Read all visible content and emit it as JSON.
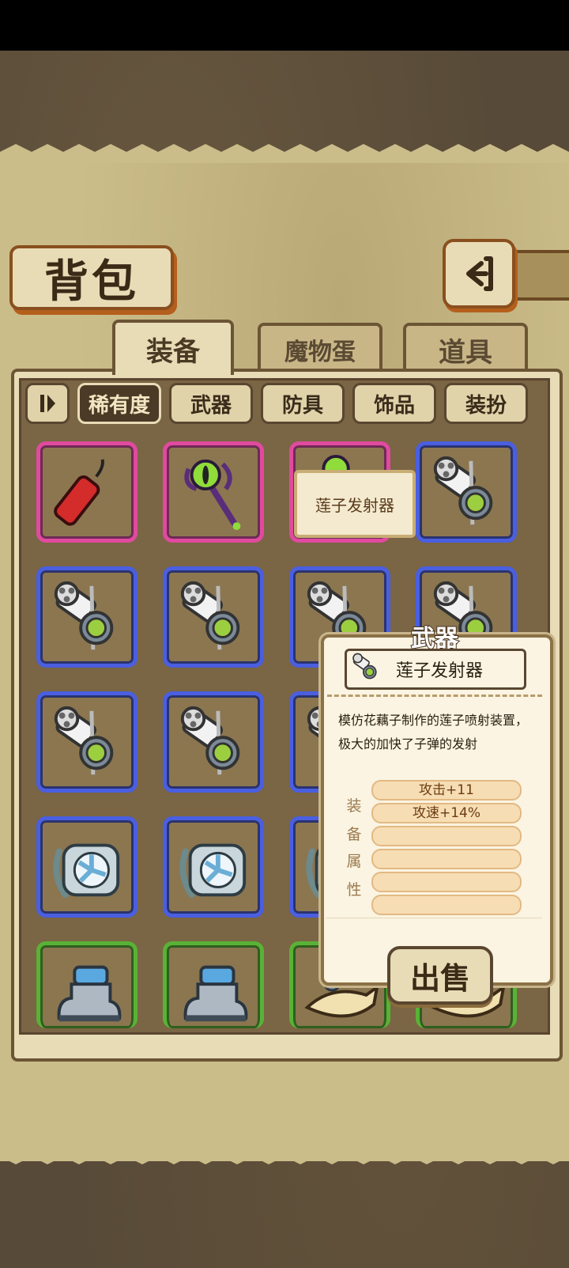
{
  "title": "背包",
  "tabs": [
    {
      "label": "装备",
      "active": true
    },
    {
      "label": "魔物蛋",
      "active": false
    },
    {
      "label": "道具",
      "active": false
    }
  ],
  "filters": [
    {
      "label": "稀有度",
      "selected": true
    },
    {
      "label": "武器",
      "selected": false
    },
    {
      "label": "防具",
      "selected": false
    },
    {
      "label": "饰品",
      "selected": false
    },
    {
      "label": "装扮",
      "selected": false
    }
  ],
  "rarity_colors": {
    "pink": "#e04a9f",
    "blue": "#4a5fe0",
    "green": "#59b236"
  },
  "tooltip": "莲子发射器",
  "detail": {
    "category": "武器",
    "name": "莲子发射器",
    "description": "模仿花藕子制作的莲子喷射装置，极大的加快了子弹的发射",
    "attr_label_chars": [
      "装",
      "备",
      "属",
      "性"
    ],
    "attributes": [
      "攻击+11",
      "攻速+14%",
      "",
      "",
      "",
      ""
    ],
    "sell_label": "出售"
  },
  "grid_items": [
    {
      "icon": "dynamite-icon",
      "rarity": "pink"
    },
    {
      "icon": "eye-staff-icon",
      "rarity": "pink"
    },
    {
      "icon": "green-orb-icon",
      "rarity": "pink"
    },
    {
      "icon": "lotus-launcher-icon",
      "rarity": "blue"
    },
    {
      "icon": "lotus-launcher-icon",
      "rarity": "blue"
    },
    {
      "icon": "lotus-launcher-icon",
      "rarity": "blue"
    },
    {
      "icon": "lotus-launcher-icon",
      "rarity": "blue"
    },
    {
      "icon": "lotus-launcher-icon",
      "rarity": "blue"
    },
    {
      "icon": "lotus-launcher-icon",
      "rarity": "blue"
    },
    {
      "icon": "lotus-launcher-icon",
      "rarity": "blue"
    },
    {
      "icon": "lotus-launcher-icon",
      "rarity": "blue"
    },
    {
      "icon": "lotus-launcher-icon",
      "rarity": "blue"
    },
    {
      "icon": "fan-bracer-icon",
      "rarity": "blue"
    },
    {
      "icon": "fan-bracer-icon",
      "rarity": "blue"
    },
    {
      "icon": "fan-bracer-icon",
      "rarity": "blue"
    },
    {
      "icon": "fan-bracer-icon",
      "rarity": "blue"
    },
    {
      "icon": "boot-icon",
      "rarity": "green"
    },
    {
      "icon": "boot-icon",
      "rarity": "green"
    },
    {
      "icon": "fish-shoe-icon",
      "rarity": "green"
    },
    {
      "icon": "fish-shoe-icon",
      "rarity": "green"
    }
  ]
}
